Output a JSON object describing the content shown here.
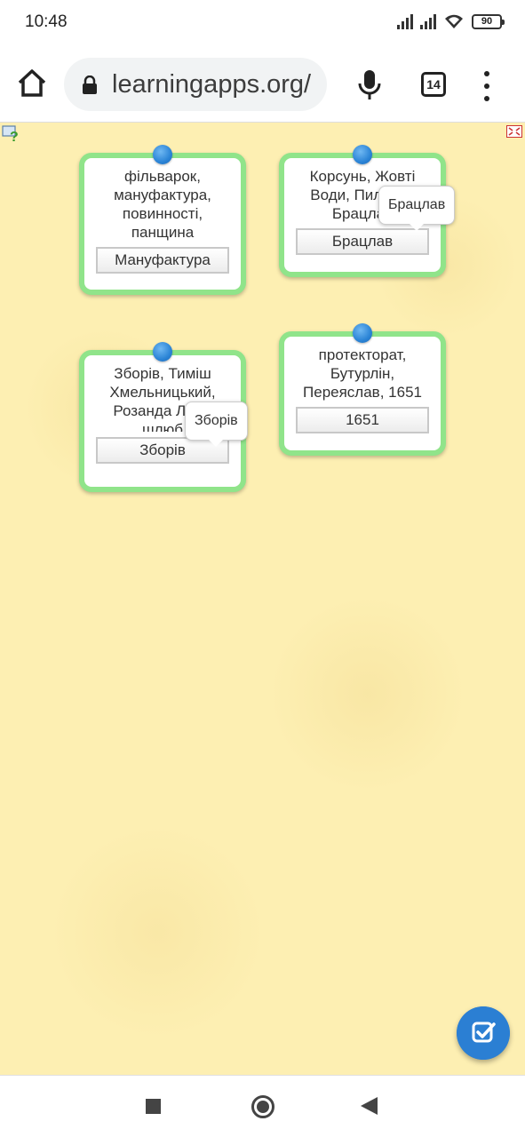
{
  "status_bar": {
    "time": "10:48",
    "battery": "90",
    "icons": [
      "signal-icon",
      "signal-icon",
      "wifi-icon",
      "battery-icon"
    ]
  },
  "browser": {
    "url": "learningapps.org/",
    "tab_count": "14",
    "icons": [
      "home-icon",
      "lock-icon",
      "mic-icon",
      "tabs-icon",
      "more-icon"
    ]
  },
  "app": {
    "icons": [
      "help-icon",
      "fullscreen-icon",
      "check-icon"
    ],
    "cards": [
      {
        "text": "фільварок,\nмануфактура,\nповинності,\nпанщина",
        "answer": "Мануфактура",
        "tooltip": ""
      },
      {
        "text": "Корсунь, Жовті\nВоди, Пилявці,\nБрацлав",
        "answer": "Брацлав",
        "tooltip": "Брацлав"
      },
      {
        "text": "Зборів, Тиміш\nХмельницький,\nРозанда Лупу,\nшлюб",
        "answer": "Зборів",
        "tooltip": "Зборів"
      },
      {
        "text": "протекторат,\nБутурлін,\nПереяслав, 1651",
        "answer": "1651",
        "tooltip": ""
      }
    ]
  },
  "nav_bar": {
    "icons": [
      "recents-icon",
      "home-nav-icon",
      "back-icon"
    ]
  }
}
